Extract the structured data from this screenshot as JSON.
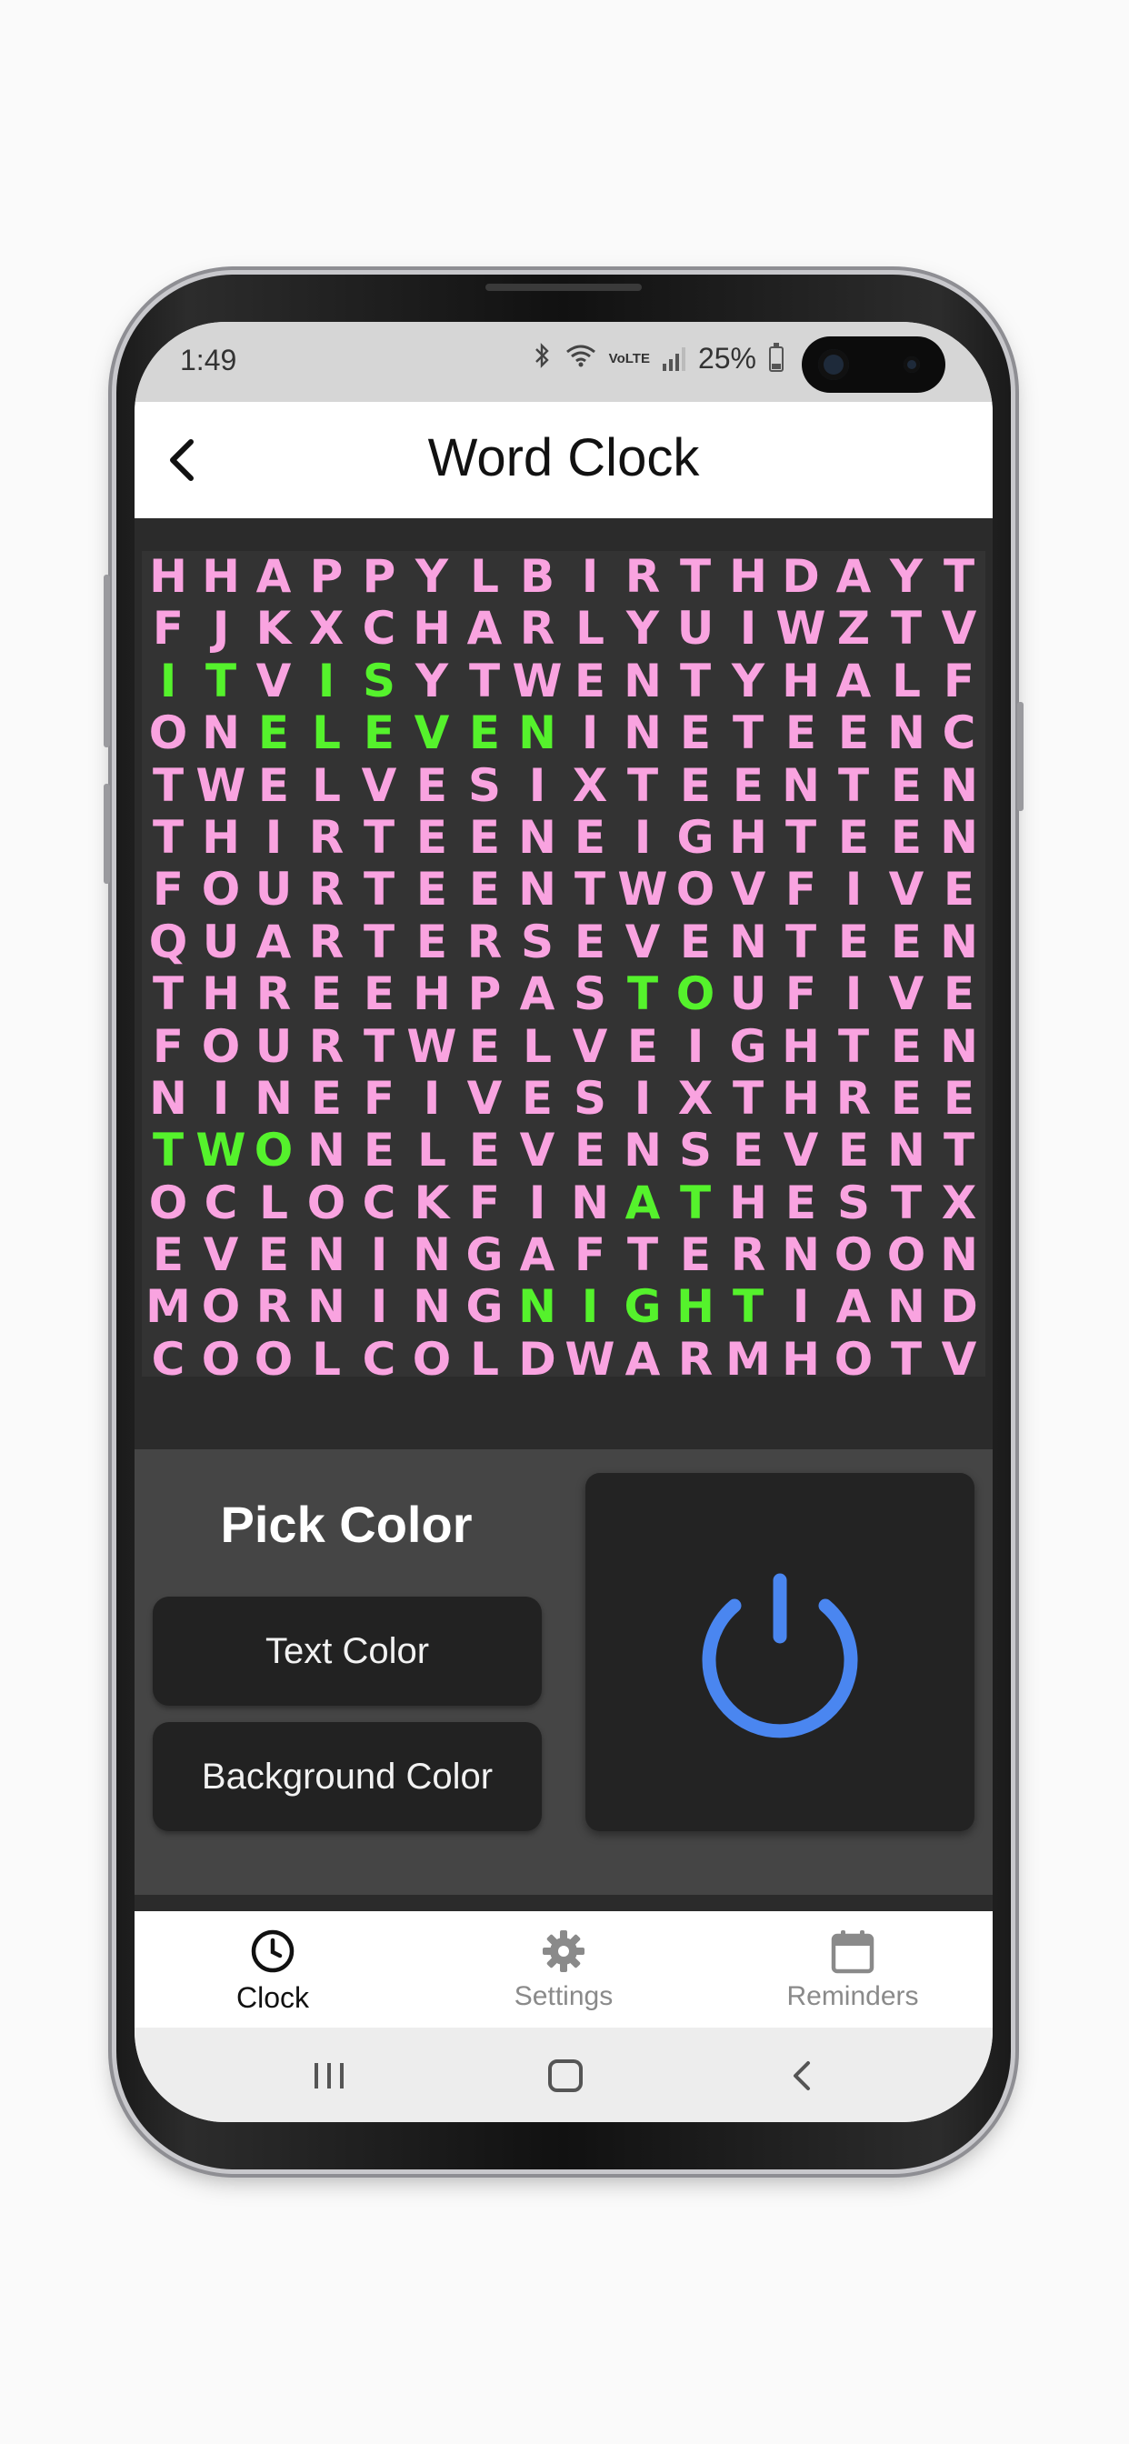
{
  "status_bar": {
    "time": "1:49",
    "battery": "25%",
    "network": "VoLTE"
  },
  "app_bar": {
    "title": "Word Clock"
  },
  "word_clock": {
    "rows": [
      "HHAPPYLBIRTHDAYT",
      "FJKXCHARLYUIWZTV",
      "ITVISYTWENTYHALF",
      "ONELEVENINETEENC",
      "TWELVESIXTEENTEN",
      "THIRTEENEIGHTEEN",
      "FOURTEENTWOVFIVE",
      "QUARTERSEVENTEEN",
      "THREEHPASTOUFIVE",
      "FOURTWELVEIGHTEN",
      "NINEFIVESIXTHREE",
      "TWONELEVENSEVENT",
      "OCLOCKFINATHESTX",
      "EVENINGAFTERNOON",
      "MORNINGNIGHTIAND",
      "COOLCOLDWARMHOTV"
    ],
    "highlighted_words": [
      {
        "text": "IT",
        "row": 2,
        "start": 0,
        "length": 2
      },
      {
        "text": "IS",
        "row": 2,
        "start": 3,
        "length": 2
      },
      {
        "text": "ELEVEN",
        "row": 3,
        "start": 2,
        "length": 6
      },
      {
        "text": "TO",
        "row": 8,
        "start": 9,
        "length": 2
      },
      {
        "text": "TWO",
        "row": 11,
        "start": 0,
        "length": 3
      },
      {
        "text": "AT",
        "row": 12,
        "start": 9,
        "length": 2
      },
      {
        "text": "NIGHT",
        "row": 14,
        "start": 7,
        "length": 5
      }
    ],
    "text_color": "#f9a3e0",
    "highlight_color": "#55f22c",
    "background_color": "#333333"
  },
  "controls": {
    "pick_color_title": "Pick Color",
    "text_color_button": "Text Color",
    "background_color_button": "Background Color",
    "power_icon": "power-icon",
    "power_color": "#4a86f0"
  },
  "bottom_nav": {
    "items": [
      {
        "label": "Clock",
        "icon": "clock-icon",
        "active": true
      },
      {
        "label": "Settings",
        "icon": "gear-icon",
        "active": false
      },
      {
        "label": "Reminders",
        "icon": "calendar-icon",
        "active": false
      }
    ]
  }
}
